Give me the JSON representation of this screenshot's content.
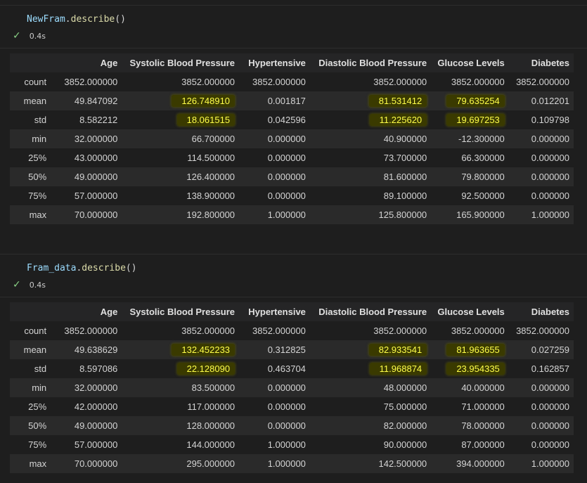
{
  "cells": [
    {
      "code": {
        "object": "NewFram",
        "dot": ".",
        "method": "describe",
        "parens": "()"
      },
      "status": {
        "check_icon": "check-icon",
        "time": "0.4s"
      },
      "columns": [
        "",
        "Age",
        "Systolic Blood Pressure",
        "Hypertensive",
        "Diastolic Blood Pressure",
        "Glucose Levels",
        "Diabetes"
      ],
      "rows": [
        {
          "label": "count",
          "values": [
            "3852.000000",
            "3852.000000",
            "3852.000000",
            "3852.000000",
            "3852.000000",
            "3852.000000"
          ]
        },
        {
          "label": "mean",
          "values": [
            "49.847092",
            "126.748910",
            "0.001817",
            "81.531412",
            "79.635254",
            "0.012201"
          ]
        },
        {
          "label": "std",
          "values": [
            "8.582212",
            "18.061515",
            "0.042596",
            "11.225620",
            "19.697253",
            "0.109798"
          ]
        },
        {
          "label": "min",
          "values": [
            "32.000000",
            "66.700000",
            "0.000000",
            "40.900000",
            "-12.300000",
            "0.000000"
          ]
        },
        {
          "label": "25%",
          "values": [
            "43.000000",
            "114.500000",
            "0.000000",
            "73.700000",
            "66.300000",
            "0.000000"
          ]
        },
        {
          "label": "50%",
          "values": [
            "49.000000",
            "126.400000",
            "0.000000",
            "81.600000",
            "79.800000",
            "0.000000"
          ]
        },
        {
          "label": "75%",
          "values": [
            "57.000000",
            "138.900000",
            "0.000000",
            "89.100000",
            "92.500000",
            "0.000000"
          ]
        },
        {
          "label": "max",
          "values": [
            "70.000000",
            "192.800000",
            "1.000000",
            "125.800000",
            "165.900000",
            "1.000000"
          ]
        }
      ]
    },
    {
      "code": {
        "object": "Fram_data",
        "dot": ".",
        "method": "describe",
        "parens": "()"
      },
      "status": {
        "check_icon": "check-icon",
        "time": "0.4s"
      },
      "columns": [
        "",
        "Age",
        "Systolic Blood Pressure",
        "Hypertensive",
        "Diastolic Blood Pressure",
        "Glucose Levels",
        "Diabetes"
      ],
      "rows": [
        {
          "label": "count",
          "values": [
            "3852.000000",
            "3852.000000",
            "3852.000000",
            "3852.000000",
            "3852.000000",
            "3852.000000"
          ]
        },
        {
          "label": "mean",
          "values": [
            "49.638629",
            "132.452233",
            "0.312825",
            "82.933541",
            "81.963655",
            "0.027259"
          ]
        },
        {
          "label": "std",
          "values": [
            "8.597086",
            "22.128090",
            "0.463704",
            "11.968874",
            "23.954335",
            "0.162857"
          ]
        },
        {
          "label": "min",
          "values": [
            "32.000000",
            "83.500000",
            "0.000000",
            "48.000000",
            "40.000000",
            "0.000000"
          ]
        },
        {
          "label": "25%",
          "values": [
            "42.000000",
            "117.000000",
            "0.000000",
            "75.000000",
            "71.000000",
            "0.000000"
          ]
        },
        {
          "label": "50%",
          "values": [
            "49.000000",
            "128.000000",
            "0.000000",
            "82.000000",
            "78.000000",
            "0.000000"
          ]
        },
        {
          "label": "75%",
          "values": [
            "57.000000",
            "144.000000",
            "1.000000",
            "90.000000",
            "87.000000",
            "0.000000"
          ]
        },
        {
          "label": "max",
          "values": [
            "70.000000",
            "295.000000",
            "1.000000",
            "142.500000",
            "394.000000",
            "1.000000"
          ]
        }
      ]
    }
  ],
  "highlight": {
    "rows": [
      "mean",
      "std"
    ],
    "columns": [
      1,
      3,
      4
    ],
    "text_color": "#ffff4a",
    "background": "#3a3a00"
  }
}
